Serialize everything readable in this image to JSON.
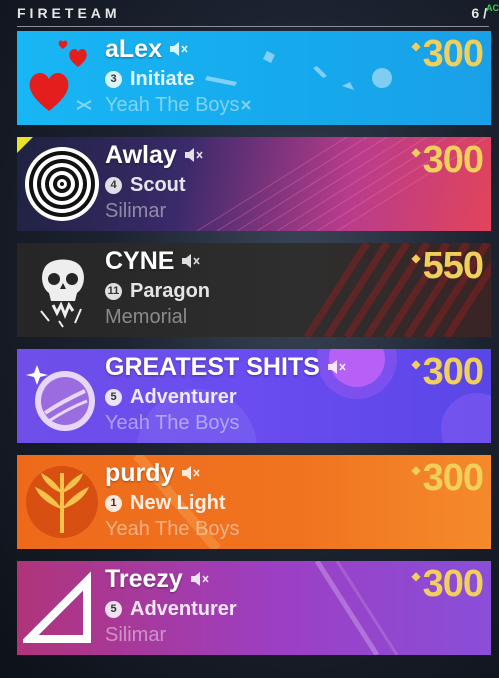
{
  "header": {
    "title": "FIRETEAM",
    "count": "6 /",
    "count_extra": "AC"
  },
  "members": [
    {
      "name": "aLex",
      "rank_number": "3",
      "rank_title": "Initiate",
      "clan": "Yeah The Boys",
      "power": "300",
      "emblem_icon": "hearts-icon",
      "background": "#18b1f0"
    },
    {
      "name": "Awlay",
      "rank_number": "4",
      "rank_title": "Scout",
      "clan": "Silimar",
      "power": "300",
      "emblem_icon": "concentric-circles-icon",
      "background": "#d93c78"
    },
    {
      "name": "CYNE",
      "rank_number": "11",
      "rank_title": "Paragon",
      "clan": "Memorial",
      "power": "550",
      "emblem_icon": "skull-icon",
      "background": "#2a2a2a"
    },
    {
      "name": "GREATEST SHITS",
      "rank_number": "5",
      "rank_title": "Adventurer",
      "clan": "Yeah The Boys",
      "power": "300",
      "emblem_icon": "shooting-star-icon",
      "background": "#6a4ff0"
    },
    {
      "name": "purdy",
      "rank_number": "1",
      "rank_title": "New Light",
      "clan": "Yeah The Boys",
      "power": "300",
      "emblem_icon": "wheat-icon",
      "background": "#f06a1c"
    },
    {
      "name": "Treezy",
      "rank_number": "5",
      "rank_title": "Adventurer",
      "clan": "Silimar",
      "power": "300",
      "emblem_icon": "triangle-icon",
      "background": "#9c3fc4"
    }
  ],
  "icons": {
    "mute": "speaker-muted-icon",
    "power": "power-diamond-icon"
  },
  "colors": {
    "power": "#f1cf5c",
    "count_extra": "#37d24b"
  }
}
